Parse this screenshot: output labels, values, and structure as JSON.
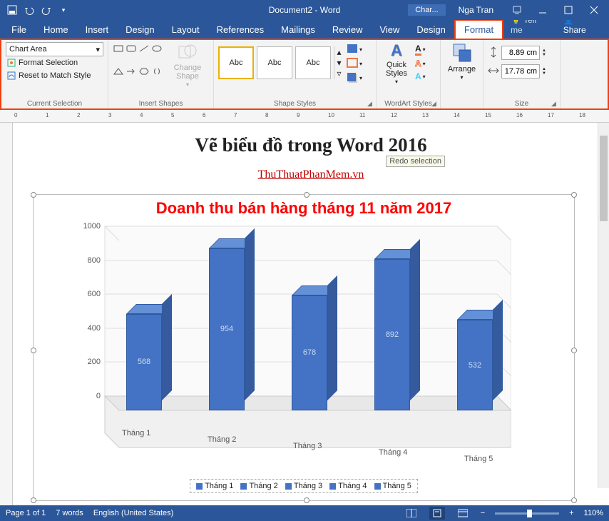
{
  "title": "Document2 - Word",
  "context_tab": "Char...",
  "user": "Nga Tran",
  "tabs": [
    "File",
    "Home",
    "Insert",
    "Design",
    "Layout",
    "References",
    "Mailings",
    "Review",
    "View",
    "Design",
    "Format"
  ],
  "tell_me": "Tell me",
  "share": "Share",
  "ribbon": {
    "sel_dropdown": "Chart Area",
    "format_selection": "Format Selection",
    "reset_match": "Reset to Match Style",
    "g1": "Current Selection",
    "change_shape": "Change Shape",
    "g2": "Insert Shapes",
    "abc": "Abc",
    "g3": "Shape Styles",
    "quick_styles": "Quick Styles",
    "g4": "WordArt Styles",
    "arrange": "Arrange",
    "height": "8.89 cm",
    "width": "17.78 cm",
    "g5": "Size"
  },
  "tooltip": "Redo selection",
  "doc": {
    "heading": "Vẽ biểu đồ trong Word 2016",
    "link": "ThuThuatPhanMem.vn"
  },
  "chart_data": {
    "type": "bar",
    "title": "Doanh thu bán hàng tháng 11 năm 2017",
    "categories": [
      "Tháng 1",
      "Tháng 2",
      "Tháng 3",
      "Tháng 4",
      "Tháng 5"
    ],
    "values": [
      568,
      954,
      678,
      892,
      532
    ],
    "ylim": [
      0,
      1000
    ],
    "yticks": [
      0,
      200,
      400,
      600,
      800,
      1000
    ],
    "legend": [
      "Tháng 1",
      "Tháng 2",
      "Tháng 3",
      "Tháng 4",
      "Tháng 5"
    ]
  },
  "status": {
    "page": "Page 1 of 1",
    "words": "7 words",
    "lang": "English (United States)",
    "zoom": "110%"
  }
}
